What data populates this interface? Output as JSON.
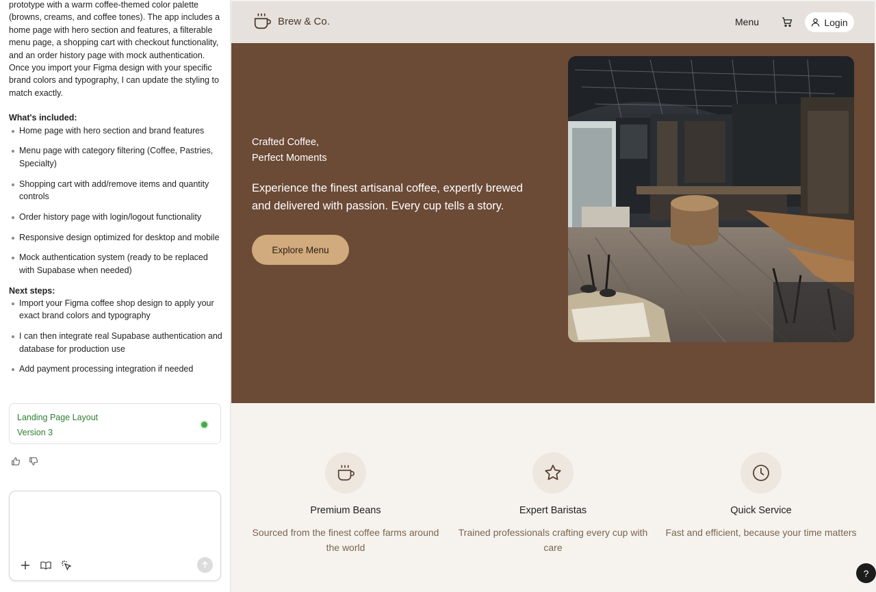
{
  "chat": {
    "intro": "prototype with a warm coffee-themed color palette (browns, creams, and coffee tones). The app includes a home page with hero section and features, a filterable menu page, a shopping cart with checkout functionality, and an order history page with mock authentication. Once you import your Figma design with your specific brand colors and typography, I can update the styling to match exactly.",
    "included_heading": "What's included:",
    "included": [
      "Home page with hero section and brand features",
      "Menu page with category filtering (Coffee, Pastries, Specialty)",
      "Shopping cart with add/remove items and quantity controls",
      "Order history page with login/logout functionality",
      "Responsive design optimized for desktop and mobile",
      "Mock authentication system (ready to be replaced with Supabase when needed)"
    ],
    "next_heading": "Next steps:",
    "next": [
      "Import your Figma coffee shop design to apply your exact brand colors and typography",
      "I can then integrate real Supabase authentication and database for production use",
      "Add payment processing integration if needed"
    ],
    "version_card": {
      "title": "Landing Page Layout",
      "version": "Version 3"
    },
    "composer": {
      "placeholder": ""
    }
  },
  "site": {
    "brand": "Brew & Co.",
    "nav": {
      "menu": "Menu",
      "login": "Login"
    },
    "hero": {
      "kicker_line1": "Crafted Coffee,",
      "kicker_line2": "Perfect Moments",
      "text": "Experience the finest artisanal coffee, expertly brewed and delivered with passion. Every cup tells a story.",
      "cta": "Explore Menu"
    },
    "features": [
      {
        "icon": "coffee-cup-icon",
        "title": "Premium Beans",
        "desc": "Sourced from the finest coffee farms around the world"
      },
      {
        "icon": "star-icon",
        "title": "Expert Baristas",
        "desc": "Trained professionals crafting every cup with care"
      },
      {
        "icon": "clock-icon",
        "title": "Quick Service",
        "desc": "Fast and efficient, because your time matters"
      }
    ]
  },
  "help": {
    "label": "?"
  },
  "colors": {
    "hero_bg": "#6b4a36",
    "nav_bg": "#e6e1dc",
    "cta": "#d1aa7d",
    "accent_green": "#2f7d32"
  }
}
